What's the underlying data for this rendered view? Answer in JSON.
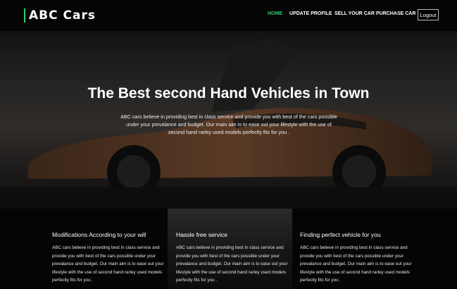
{
  "brand": {
    "name": "ABC Cars",
    "accent_color": "#2ecc71"
  },
  "nav": {
    "home": "HOME",
    "update_profile": "UPDATE PROFILE",
    "sell_car": "SELL YOUR CAR",
    "purchase_car": "PURCHASE CAR",
    "logout": "Logout"
  },
  "hero": {
    "title": "The Best second Hand Vehicles in Town",
    "description": "ABC cars believe in providing best in class service and provide you with best of the cars possible under your prevalance and budget. Our main aim is to ease out your lifestyle with the use of second hand rarley used models perfectly fits for you ."
  },
  "features": [
    {
      "title": "Modifications According to your will",
      "text": "ABC cars believe in providing best in class service and provide you with best of the cars possible under your prevalance and budget. Our main aim is to ease out your lifestyle with the use of second hand rarley used models perfectly fits for you ."
    },
    {
      "title": "Hassle free service",
      "text": "ABC cars believe in providing best in class service and provide you with best of the cars possible under your prevalance and budget. Our main aim is to ease out your lifestyle with the use of second hand rarley used models perfectly fits for you ."
    },
    {
      "title": "Finding perfect vehicle for you",
      "text": "ABC cars believe in providing best in class service and provide you with best of the cars possible under your prevalance and budget. Our main aim is to ease out your lifestyle with the use of second hand rarley used models perfectly fits for you ."
    }
  ]
}
